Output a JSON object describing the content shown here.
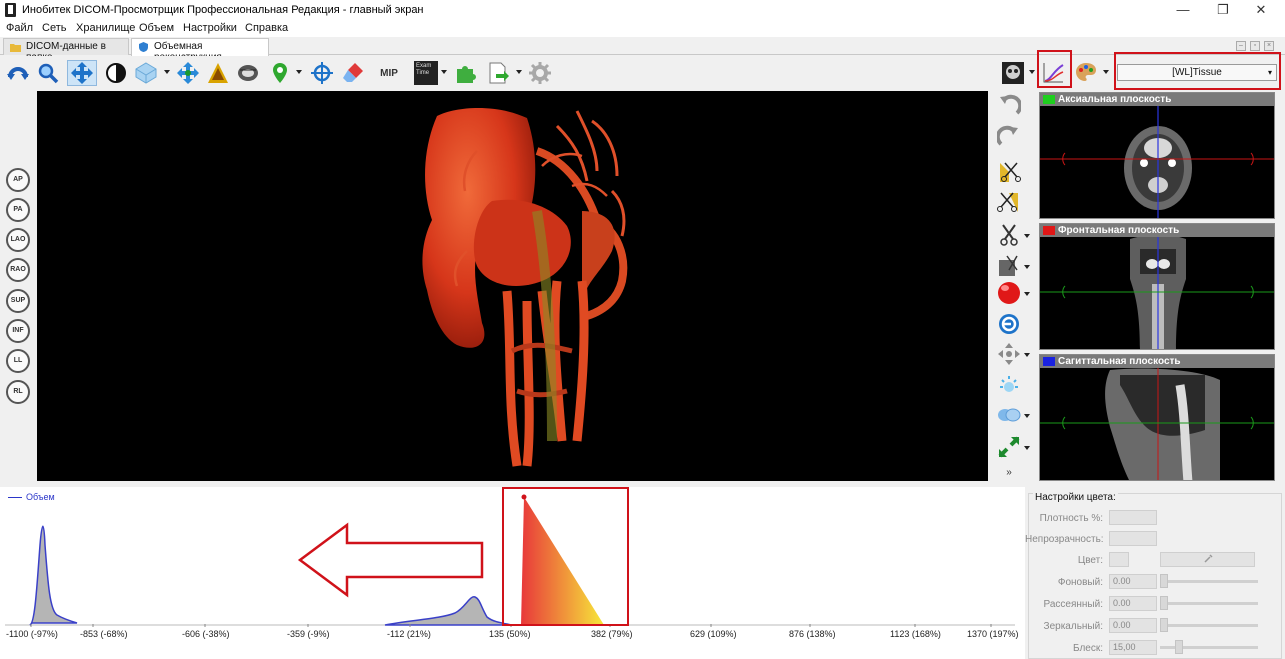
{
  "window": {
    "title": "Инобитек DICOM-Просмотрщик Профессиональная Редакция - главный экран",
    "minimize": "—",
    "maximize": "❐",
    "close": "✕"
  },
  "menu": [
    "Файл",
    "Сеть",
    "Хранилище",
    "Объем",
    "Настройки",
    "Справка"
  ],
  "tabs": [
    {
      "label": "DICOM-данные в папке",
      "active": false
    },
    {
      "label": "Объемная реконструкция",
      "active": true
    }
  ],
  "toolbar": {
    "mip_label": "MIP",
    "exam_label": "Exam\nTime",
    "preset_value": "[WL]Tissue"
  },
  "orientation_buttons": [
    "AP",
    "PA",
    "LAO",
    "RAO",
    "SUP",
    "INF",
    "LL",
    "RL"
  ],
  "panes": [
    {
      "title": "Аксиальная плоскость",
      "color": "#1fcf1f"
    },
    {
      "title": "Фронтальная плоскость",
      "color": "#e01818"
    },
    {
      "title": "Сагиттальная плоскость",
      "color": "#1a22e0"
    }
  ],
  "histogram": {
    "legend": "Объем",
    "ticks": [
      "-1100 (-97%)",
      "-853 (-68%)",
      "-606 (-38%)",
      "-359 (-9%)",
      "-112 (21%)",
      "135 (50%)",
      "382 (79%)",
      "629 (109%)",
      "876 (138%)",
      "1123 (168%)",
      "1370 (197%)"
    ]
  },
  "color_settings": {
    "title": "Настройки цвета:",
    "density_label": "Плотность %:",
    "opacity_label": "Непрозрачность:",
    "color_label": "Цвет:",
    "ambient_label": "Фоновый:",
    "ambient_value": "0.00",
    "diffuse_label": "Рассеянный:",
    "diffuse_value": "0.00",
    "specular_label": "Зеркальный:",
    "specular_value": "0.00",
    "shininess_label": "Блеск:",
    "shininess_value": "15,00"
  },
  "colors": {
    "highlight": "#d0121a",
    "toolbar_blue": "#1e73c9",
    "histogram_line": "#2b36c9",
    "volume": "#e0401c"
  }
}
